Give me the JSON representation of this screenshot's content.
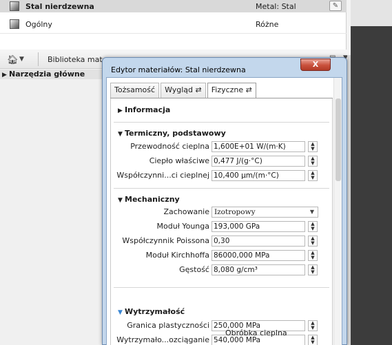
{
  "materials": {
    "rows": [
      {
        "name": "Stal nierdzewna",
        "category": "Metal: Stal",
        "selected": true
      },
      {
        "name": "Ogólny",
        "category": "Różne",
        "selected": false
      }
    ]
  },
  "breadcrumb": {
    "label": "Biblioteka mater"
  },
  "tree": {
    "header": "Narzędzia główne"
  },
  "dialog": {
    "title": "Edytor materiałów: Stal nierdzewna",
    "close_label": "X",
    "tabs": [
      {
        "label": "Tożsamość"
      },
      {
        "label": "Wygląd ⇄"
      },
      {
        "label": "Fizyczne ⇄"
      }
    ],
    "sections": {
      "info": "Informacja",
      "thermal": "Termiczny, podstawowy",
      "mechanical": "Mechaniczny",
      "strength": "Wytrzymałość"
    },
    "thermal": [
      {
        "label": "Przewodność cieplna",
        "value": "1,600E+01 W/(m·K)"
      },
      {
        "label": "Ciepło właściwe",
        "value": "0,477 J/(g·°C)"
      },
      {
        "label": "Współczynni...ci cieplnej",
        "value": "10,400 µm/(m·°C)"
      }
    ],
    "mechanical": {
      "behaviour_label": "Zachowanie",
      "behaviour_value": "Izotropowy",
      "fields": [
        {
          "label": "Moduł Younga",
          "value": "193,000 GPa"
        },
        {
          "label": "Współczynnik Poissona",
          "value": "0,30"
        },
        {
          "label": "Moduł Kirchhoffa",
          "value": "86000,000 MPa"
        },
        {
          "label": "Gęstość",
          "value": "8,080 g/cm³"
        }
      ]
    },
    "strength": {
      "fields": [
        {
          "label": "Granica plastyczności",
          "value": "250,000 MPa"
        },
        {
          "label": "Wytrzymało...ozciąganie",
          "value": "540,000 MPa"
        }
      ],
      "checkbox_label": "Obróbka cieplna"
    }
  }
}
